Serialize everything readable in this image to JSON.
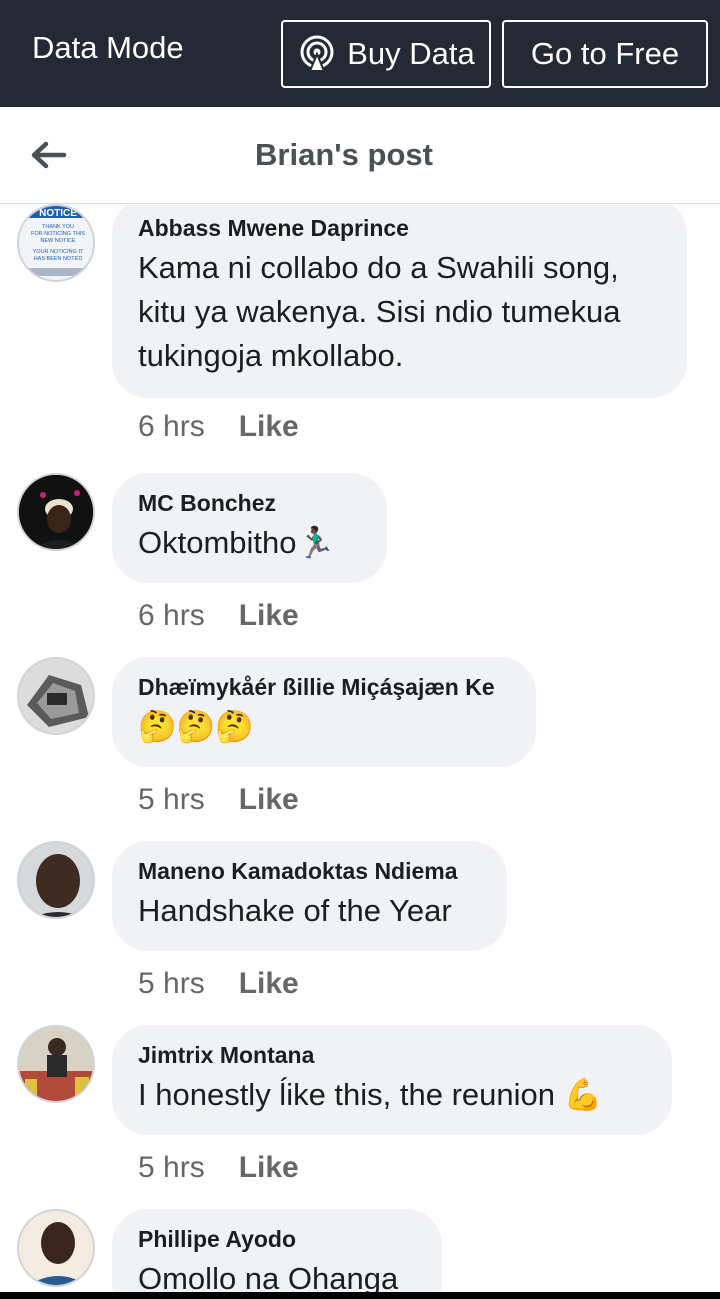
{
  "topbar": {
    "mode_label": "Data Mode",
    "buy_label": "Buy Data",
    "free_label": "Go to Free"
  },
  "header": {
    "title": "Brian's post"
  },
  "comments": [
    {
      "name": "Abbass Mwene Daprince",
      "text": "Kama ni collabo do a Swahili song, kitu ya wakenya. Sisi ndio tumekua tukingoja mkollabo.",
      "time": "6 hrs",
      "like": "Like"
    },
    {
      "name": "MC Bonchez",
      "text": "Oktombitho🏃🏿‍♂️",
      "time": "6 hrs",
      "like": "Like"
    },
    {
      "name": "Dhæïmykåér ßillie Miçáşajæn Ke",
      "text": "🤔🤔🤔",
      "time": "5 hrs",
      "like": "Like"
    },
    {
      "name": "Maneno Kamadoktas Ndiema",
      "text": "Handshake of the Year",
      "time": "5 hrs",
      "like": "Like"
    },
    {
      "name": "Jimtrix Montana",
      "text": "I honestly ĺike this, the reunion 💪",
      "time": "5 hrs",
      "like": "Like"
    },
    {
      "name": "Phillipe Ayodo",
      "text": "Omollo na Ohanga",
      "time": "",
      "like": ""
    }
  ],
  "avatar_notice": {
    "title": "NOTICE",
    "line1": "THANK YOU",
    "line2": "FOR NOTICING THIS",
    "line3": "NEW NOTICE",
    "line4": "YOUR NOTICING IT",
    "line5": "HAS BEEN NOTED"
  }
}
